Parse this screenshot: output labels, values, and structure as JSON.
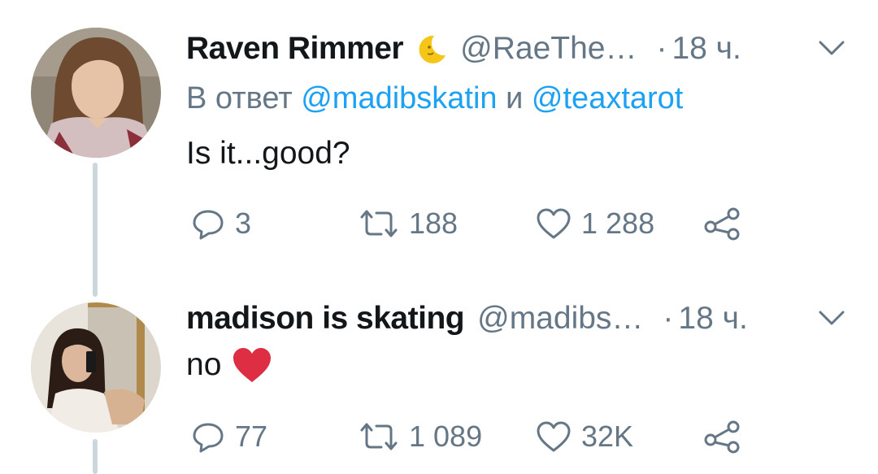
{
  "tweets": [
    {
      "display_name": "Raven Rimmer",
      "name_emoji": "crescent-moon-face-icon",
      "handle": "@RaeThe…",
      "time_sep": "·",
      "time": "18 ч.",
      "reply_prefix": "В ответ",
      "reply_mention_1": "@madibskatin",
      "reply_conj": "и",
      "reply_mention_2": "@teaxtarot",
      "text": "Is it...good?",
      "replies": "3",
      "retweets": "188",
      "likes": "1 288"
    },
    {
      "display_name": "madison is skating",
      "handle": "@madibs…",
      "time_sep": "·",
      "time": "18 ч.",
      "text": "no",
      "text_emoji": "red-heart-icon",
      "replies": "77",
      "retweets": "1 089",
      "likes": "32K"
    }
  ],
  "colors": {
    "secondary_text": "#657786",
    "link": "#1da1f2",
    "thread_line": "#ccd6dd",
    "heart": "#e0245e"
  }
}
